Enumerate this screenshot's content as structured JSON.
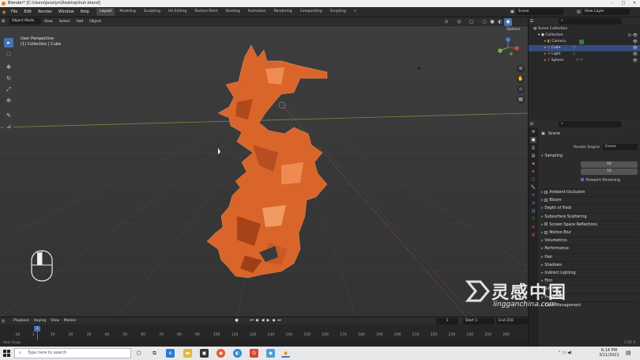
{
  "window": {
    "title": "Blender* [C:\\Users\\Jocelyn\\Desktop\\huh.blend]"
  },
  "menu": {
    "items": [
      "File",
      "Edit",
      "Render",
      "Window",
      "Help"
    ]
  },
  "workspaces": [
    "Layout",
    "Modeling",
    "Sculpting",
    "UV Editing",
    "Texture Paint",
    "Shading",
    "Animation",
    "Rendering",
    "Compositing",
    "Scripting"
  ],
  "scene_field": {
    "value": "Scene"
  },
  "view_layer_field": {
    "value": "View Layer"
  },
  "viewport_header": {
    "mode": "Object Mode",
    "items": [
      "View",
      "Select",
      "Add",
      "Object"
    ],
    "options": "Options"
  },
  "viewport_info": {
    "line1": "User Perspective",
    "line2": "(1) Collection | Cube"
  },
  "outliner": {
    "root": "Scene Collection",
    "collection": "Collection",
    "items": [
      "Camera",
      "Cube",
      "Light",
      "Sphere"
    ]
  },
  "properties": {
    "scene_label": "Scene",
    "render_engine_label": "Render Engine",
    "render_engine_value": "Eevee",
    "sampling": "Sampling",
    "render_label": "Render",
    "render_value": "64",
    "viewport_label": "Viewport",
    "viewport_value": "16",
    "viewport_denoising": "Viewport Denoising",
    "panels": [
      "Ambient Occlusion",
      "Bloom",
      "Depth of Field",
      "Subsurface Scattering",
      "Screen Space Reflections",
      "Motion Blur",
      "Volumetrics",
      "Performance",
      "Hair",
      "Shadows",
      "Indirect Lighting",
      "Film",
      "Simplify",
      "Freestyle",
      "Color Management"
    ]
  },
  "timeline": {
    "menu": [
      "Playback",
      "Keying",
      "View",
      "Marker"
    ],
    "current_frame": "1",
    "start_label": "Start",
    "start": "1",
    "end_label": "End",
    "end": "250",
    "frames": [
      "-10",
      "1",
      "10",
      "20",
      "30",
      "40",
      "50",
      "60",
      "70",
      "80",
      "90",
      "100",
      "110",
      "120",
      "130",
      "140",
      "150",
      "160",
      "170",
      "180",
      "190",
      "200",
      "210",
      "220",
      "230",
      "240",
      "250",
      "260"
    ]
  },
  "statusbar": {
    "left": "Axis Snap",
    "version": "2.91.0"
  },
  "taskbar": {
    "search_placeholder": "Type here to search",
    "time": "6:14 PM",
    "date": "3/11/2021"
  },
  "watermark": {
    "chinese": "灵感中国",
    "url": "lingganchina.com"
  },
  "colors": {
    "accent": "#4772b3",
    "model": "#e0652e",
    "viewport_bg": "#3a3a3a",
    "selected_row": "#334d80"
  }
}
